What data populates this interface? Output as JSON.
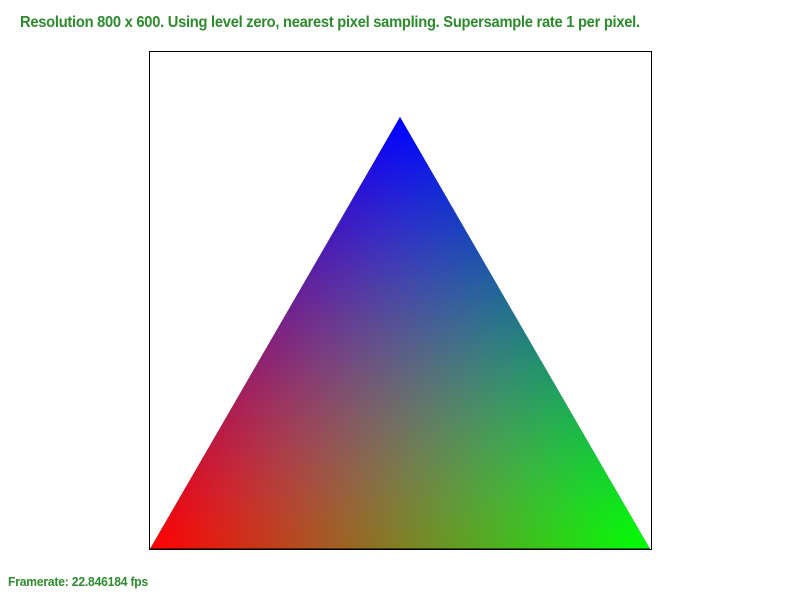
{
  "hud": {
    "status_line": "Resolution 800 x 600. Using level zero, nearest pixel sampling. Supersample rate 1 per pixel.",
    "framerate_line": "Framerate: 22.846184 fps",
    "text_color": "#2d8a2d"
  },
  "scene": {
    "primitive": "triangle",
    "vertex_colors": {
      "top": "#0000ff",
      "bottom_left": "#ff0000",
      "bottom_right": "#00ff00"
    },
    "frame_color": "#000000",
    "background": "#ffffff"
  }
}
